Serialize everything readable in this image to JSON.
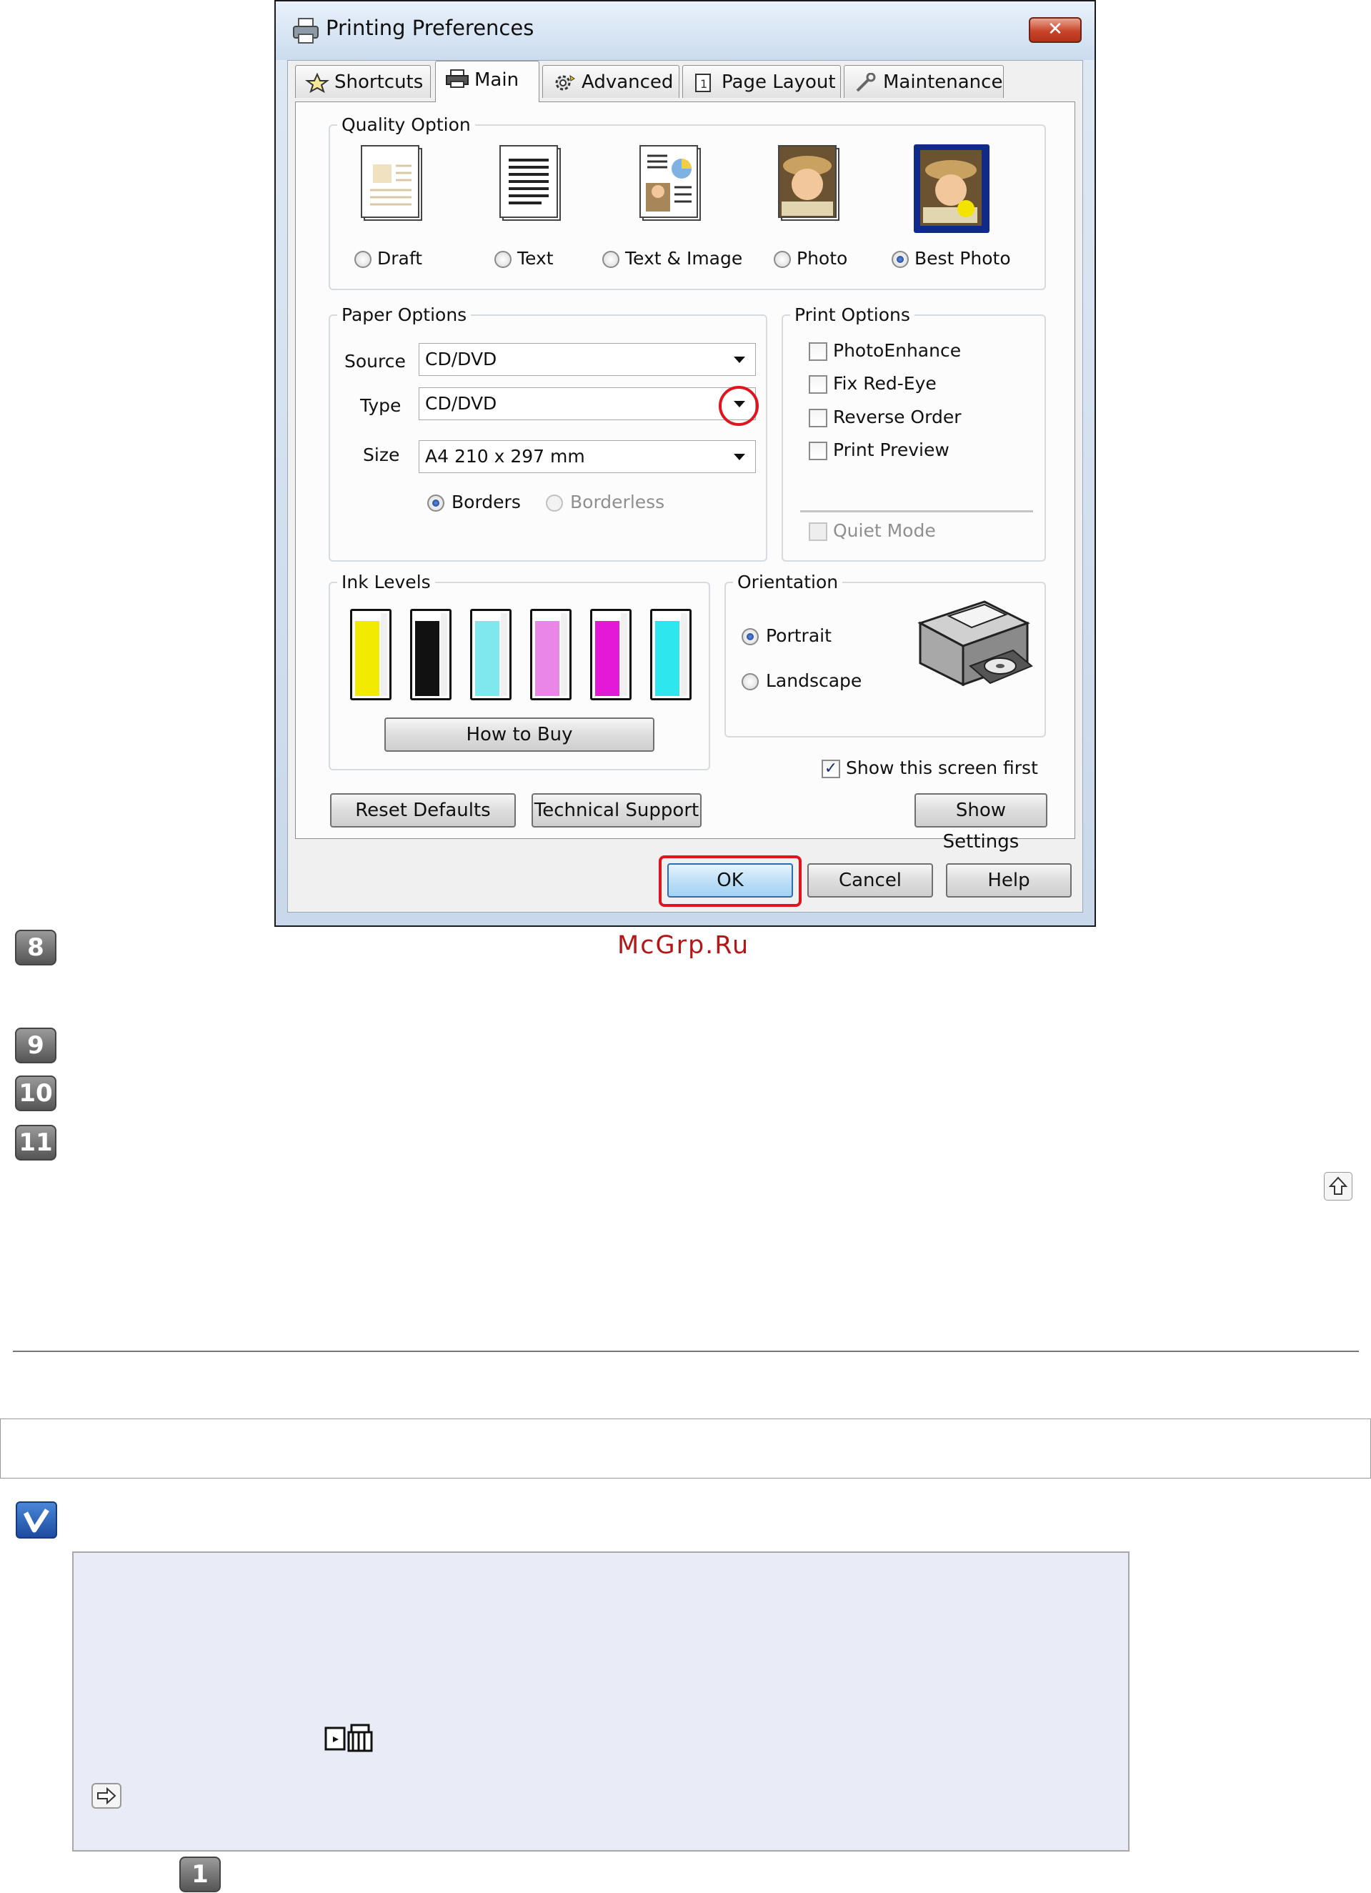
{
  "dialog": {
    "title": "Printing Preferences",
    "close_glyph": "✕",
    "tabs": [
      {
        "label": "Shortcuts",
        "icon": "star-icon"
      },
      {
        "label": "Main",
        "icon": "printer-icon",
        "active": true
      },
      {
        "label": "Advanced",
        "icon": "gear-icon"
      },
      {
        "label": "Page Layout",
        "icon": "page-layout-icon"
      },
      {
        "label": "Maintenance",
        "icon": "wrench-icon"
      }
    ],
    "quality": {
      "title": "Quality Option",
      "options": [
        {
          "label": "Draft",
          "selected": false
        },
        {
          "label": "Text",
          "selected": false
        },
        {
          "label": "Text & Image",
          "selected": false
        },
        {
          "label": "Photo",
          "selected": false
        },
        {
          "label": "Best Photo",
          "selected": true
        }
      ]
    },
    "paper": {
      "title": "Paper Options",
      "source_label": "Source",
      "source_value": "CD/DVD",
      "type_label": "Type",
      "type_value": "CD/DVD",
      "size_label": "Size",
      "size_value": "A4 210 x 297 mm",
      "borders_label": "Borders",
      "borderless_label": "Borderless"
    },
    "print_options": {
      "title": "Print Options",
      "items": [
        {
          "label": "PhotoEnhance",
          "checked": false
        },
        {
          "label": "Fix Red-Eye",
          "checked": false
        },
        {
          "label": "Reverse Order",
          "checked": false
        },
        {
          "label": "Print Preview",
          "checked": false
        }
      ],
      "quiet_mode_label": "Quiet Mode"
    },
    "ink": {
      "title": "Ink Levels",
      "colors": [
        "#f2ea00",
        "#111111",
        "#7fe8ee",
        "#e986e6",
        "#e21ad8",
        "#2ee6ee"
      ],
      "how_to_buy": "How to Buy"
    },
    "orientation": {
      "title": "Orientation",
      "portrait_label": "Portrait",
      "landscape_label": "Landscape"
    },
    "show_screen_first": "Show this screen first",
    "check_mark": "✓",
    "buttons": {
      "reset_defaults": "Reset Defaults",
      "technical_support": "Technical Support",
      "show_settings": "Show Settings",
      "ok": "OK",
      "cancel": "Cancel",
      "help": "Help"
    },
    "highlight_color": "#e0141e"
  },
  "steps": {
    "s8": "8",
    "s9": "9",
    "s10": "10",
    "s11": "11",
    "s1": "1"
  },
  "watermark": "McGrp.Ru"
}
